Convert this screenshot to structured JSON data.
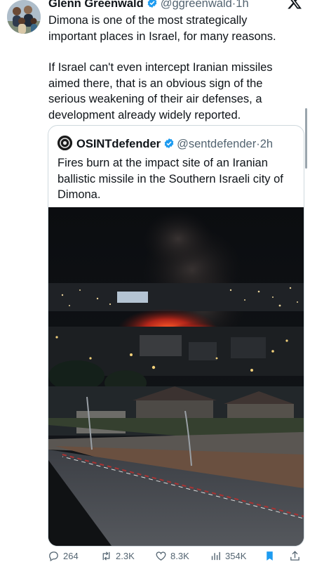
{
  "tweet": {
    "author_name": "Glenn Greenwald",
    "author_handle": "@ggreenwald",
    "separator": "·",
    "time": "1h",
    "paragraph1": "Dimona is one of the most strategically\nimportant places in Israel, for many reasons.",
    "paragraph2": "If Israel can't even intercept Iranian missiles\naimed there, that is an obvious sign of the\nserious weakening of their air defenses, a\ndevelopment already widely reported."
  },
  "quoted_tweet": {
    "author_name": "OSINTdefender",
    "author_handle": "@sentdefender",
    "separator": "·",
    "time": "2h",
    "text": "Fires burn at the impact site of an Iranian ballistic missile in the Southern Israeli city of Dimona."
  },
  "actions": {
    "replies": "264",
    "reposts": "2.3K",
    "likes": "8.3K",
    "views": "354K"
  },
  "colors": {
    "verified_badge": "#1d9bf0",
    "secondary_text": "#536471",
    "bookmark_active": "#1d9bf0"
  },
  "icons": [
    "verified-badge-icon",
    "x-logo-icon",
    "reply-icon",
    "repost-icon",
    "like-icon",
    "views-icon",
    "bookmark-icon",
    "share-icon"
  ]
}
